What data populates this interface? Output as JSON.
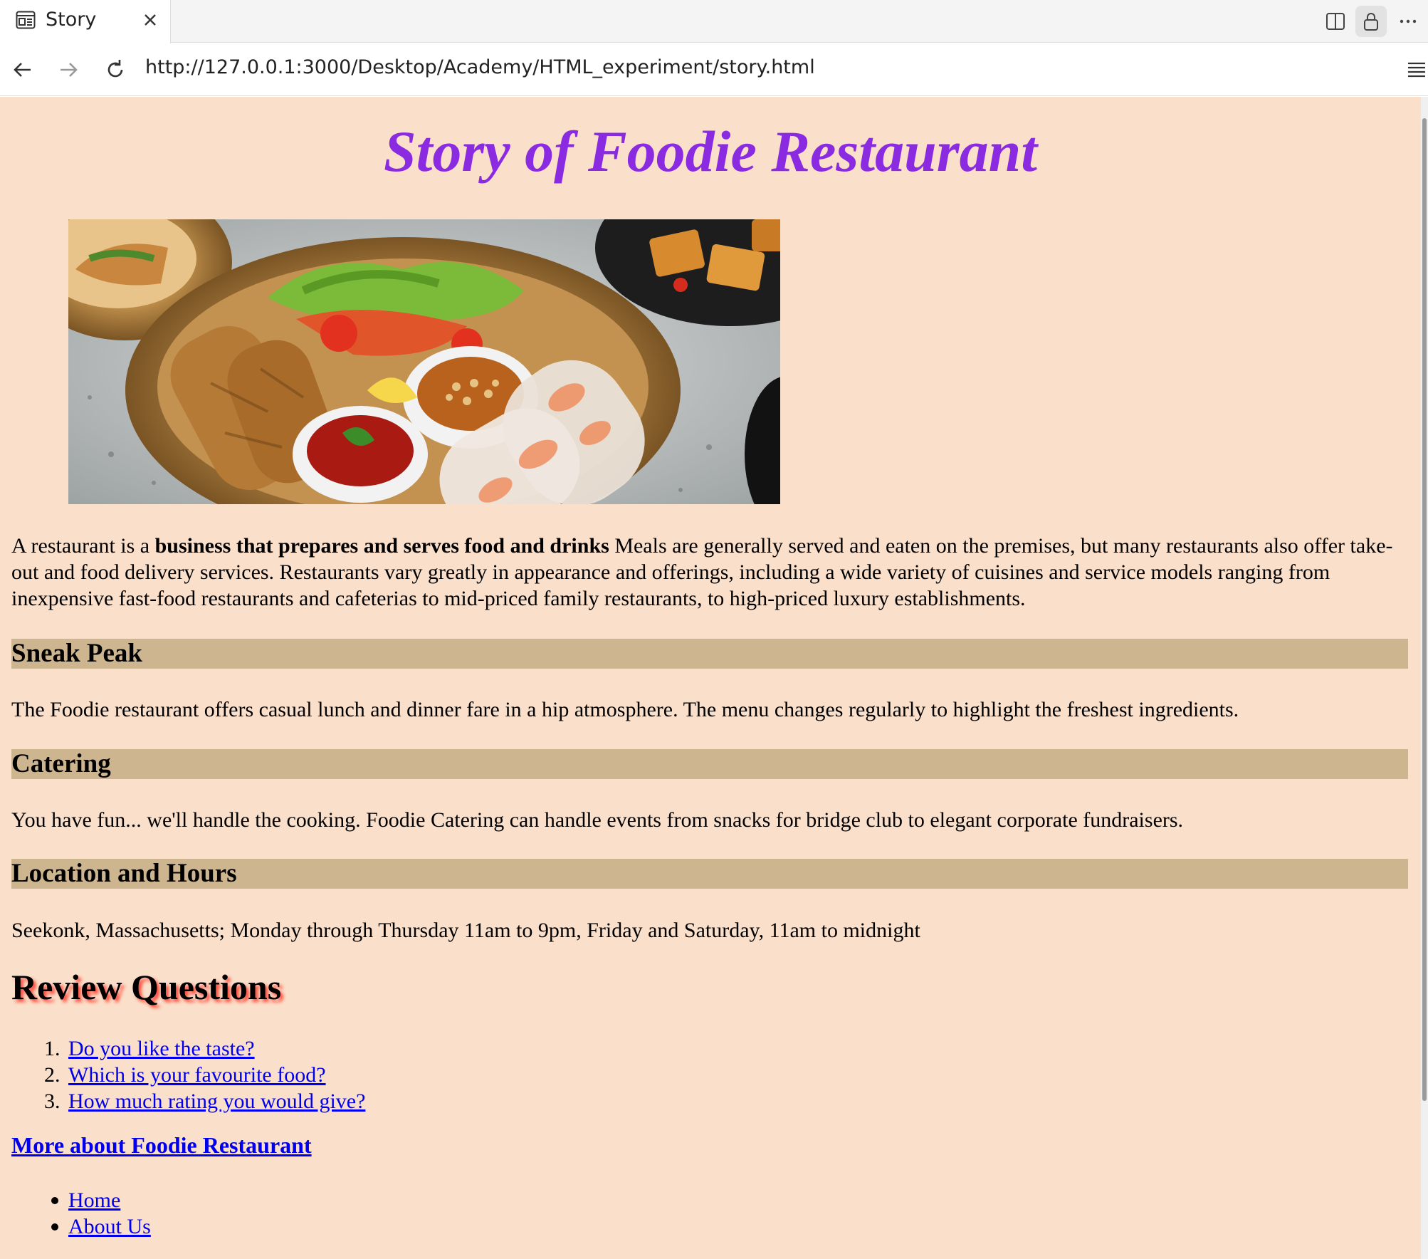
{
  "browser": {
    "tab_title": "Story",
    "url": "http://127.0.0.1:3000/Desktop/Academy/HTML_experiment/story.html",
    "icons": [
      "page-icon",
      "close-icon",
      "split-view-icon",
      "lock-icon",
      "more-icon",
      "back-arrow-icon",
      "forward-arrow-icon",
      "reload-icon",
      "reader-mode-icon"
    ]
  },
  "page": {
    "background_color": "#fadfca",
    "title": "Story of Foodie Restaurant",
    "title_color": "#8a2be2",
    "hero_image": "photo of spring rolls, fresh rolls, salad and dipping sauces in a basket",
    "intro": {
      "prefix": "A restaurant is a ",
      "bold": "business that prepares and serves food and drinks",
      "suffix": " Meals are generally served and eaten on the premises, but many restaurants also offer take-out and food delivery services. Restaurants vary greatly in appearance and offerings, including a wide variety of cuisines and service models ranging from inexpensive fast-food restaurants and cafeterias to mid-priced family restaurants, to high-priced luxury establishments."
    },
    "sections": [
      {
        "heading": "Sneak Peak",
        "text": "The Foodie restaurant offers casual lunch and dinner fare in a hip atmosphere. The menu changes regularly to highlight the freshest ingredients."
      },
      {
        "heading": "Catering",
        "text": "You have fun... we'll handle the cooking. Foodie Catering can handle events from snacks for bridge club to elegant corporate fundraisers."
      },
      {
        "heading": "Location and Hours",
        "text": "Seekonk, Massachusetts; Monday through Thursday 11am to 9pm, Friday and Saturday, 11am to midnight"
      }
    ],
    "section_heading_color": "#cdb590",
    "review": {
      "title": "Review Questions",
      "questions": [
        {
          "num": "1.",
          "label": "Do you like the taste?"
        },
        {
          "num": "2.",
          "label": "Which is your favourite food?"
        },
        {
          "num": "3.",
          "label": "How much rating you would give?"
        }
      ]
    },
    "more_link": "More about Foodie Restaurant",
    "nav_links": [
      "Home",
      "About Us"
    ]
  }
}
